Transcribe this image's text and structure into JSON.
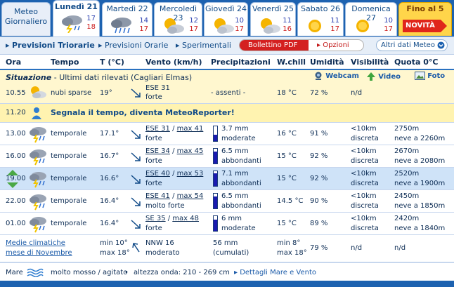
{
  "tabs": {
    "meteo": {
      "line1": "Meteo",
      "line2": "Giornaliero"
    },
    "days": [
      {
        "name": "Lunedì 21",
        "hi": "17",
        "lo": "18",
        "icon": "storm-rain-icon"
      },
      {
        "name": "Martedì 22",
        "hi": "14",
        "lo": "17",
        "icon": "heavy-rain-icon"
      },
      {
        "name": "Mercoledì 23",
        "hi": "12",
        "lo": "17",
        "icon": "sun-cloud-icon"
      },
      {
        "name": "Giovedì 24",
        "hi": "10",
        "lo": "17",
        "icon": "sun-cloud-icon"
      },
      {
        "name": "Venerdì 25",
        "hi": "11",
        "lo": "16",
        "icon": "sun-cloud-icon"
      },
      {
        "name": "Sabato 26",
        "hi": "11",
        "lo": "17",
        "icon": "sun-icon"
      },
      {
        "name": "Domenica 27",
        "hi": "10",
        "lo": "17",
        "icon": "sun-icon"
      }
    ],
    "fino": {
      "label": "Fino al 5",
      "badge": "NOVITÀ"
    }
  },
  "toolbar": {
    "triorarie": "Previsioni Triorarie",
    "orarie": "Previsioni Orarie",
    "sperimentali": "Sperimentali",
    "bollettino": "Bollettino PDF",
    "opzioni": "Opzioni",
    "altri": "Altri dati Meteo"
  },
  "headers": {
    "ora": "Ora",
    "tempo": "Tempo",
    "temp": "T (°C)",
    "vento": "Vento (km/h)",
    "prec": "Precipitazioni",
    "wchill": "W.chill",
    "umid": "Umidità",
    "visib": "Visibilità",
    "quota": "Quota 0°C"
  },
  "situazione": {
    "title": "Situazione",
    "desc": "- Ultimi dati rilevati (Cagliari Elmas)",
    "webcam": "Webcam",
    "video": "Video",
    "foto": "Foto",
    "time": "10.55",
    "tempo": "nubi sparse",
    "temp": "19°",
    "wind": "ESE 31",
    "wind_desc": "forte",
    "prec": "- assenti -",
    "wchill": "18 °C",
    "umid": "72 %",
    "visib": "n/d"
  },
  "advert": {
    "time": "11.20",
    "text": "Segnala il tempo, diventa MeteoReporter!"
  },
  "rows": [
    {
      "time": "13.00",
      "tempo": "temporale",
      "temp": "17.1°",
      "wind": "ESE 31",
      "max": "max 41",
      "wind_desc": "forte",
      "prec": "3.7 mm",
      "prec_desc": "moderate",
      "prec_level": 0.45,
      "wchill": "16 °C",
      "umid": "91 %",
      "visib": "<10km",
      "visib_desc": "discreta",
      "quota": "2750m",
      "neve": "neve a 2260m"
    },
    {
      "time": "16.00",
      "tempo": "temporale",
      "temp": "16.7°",
      "wind": "ESE 34",
      "max": "max 45",
      "wind_desc": "forte",
      "prec": "6.5 mm",
      "prec_desc": "abbondanti",
      "prec_level": 0.8,
      "wchill": "15 °C",
      "umid": "92 %",
      "visib": "<10km",
      "visib_desc": "discreta",
      "quota": "2670m",
      "neve": "neve a 2080m"
    },
    {
      "time": "19.00",
      "tempo": "temporale",
      "temp": "16.6°",
      "wind": "ESE 40",
      "max": "max 53",
      "wind_desc": "forte",
      "prec": "7.1 mm",
      "prec_desc": "abbondanti",
      "prec_level": 0.88,
      "wchill": "15 °C",
      "umid": "92 %",
      "visib": "<10km",
      "visib_desc": "discreta",
      "quota": "2520m",
      "neve": "neve a 1900m"
    },
    {
      "time": "22.00",
      "tempo": "temporale",
      "temp": "16.4°",
      "wind": "ESE 41",
      "max": "max 54",
      "wind_desc": "molto forte",
      "prec": "6.5 mm",
      "prec_desc": "abbondanti",
      "prec_level": 0.8,
      "wchill": "14.5 °C",
      "umid": "90 %",
      "visib": "<10km",
      "visib_desc": "discreta",
      "quota": "2450m",
      "neve": "neve a 1850m"
    },
    {
      "time": "01.00",
      "tempo": "temporale",
      "temp": "16.4°",
      "wind": "SE 35",
      "max": "max 48",
      "wind_desc": "forte",
      "prec": "6 mm",
      "prec_desc": "moderate",
      "prec_level": 0.75,
      "wchill": "15 °C",
      "umid": "89 %",
      "visib": "<10km",
      "visib_desc": "discreta",
      "quota": "2420m",
      "neve": "neve a 1840m"
    }
  ],
  "clima": {
    "label1": "Medie climatiche",
    "label2": "mese di Novembre",
    "tmin": "min 10°",
    "tmax": "max 18°",
    "wind": "NNW 16",
    "wind_desc": "moderato",
    "prec": "56 mm",
    "prec_desc": "(cumulati)",
    "wmin": "min 8°",
    "wmax": "max 18°",
    "umid": "79 %",
    "visib": "n/d",
    "quota": "n/d"
  },
  "mare": {
    "label": "Mare",
    "state": "molto mosso / agitato",
    "bullet": "•",
    "onda": "altezza onda: 210 - 269 cm",
    "dettagli": "Dettagli Mare e Vento"
  }
}
